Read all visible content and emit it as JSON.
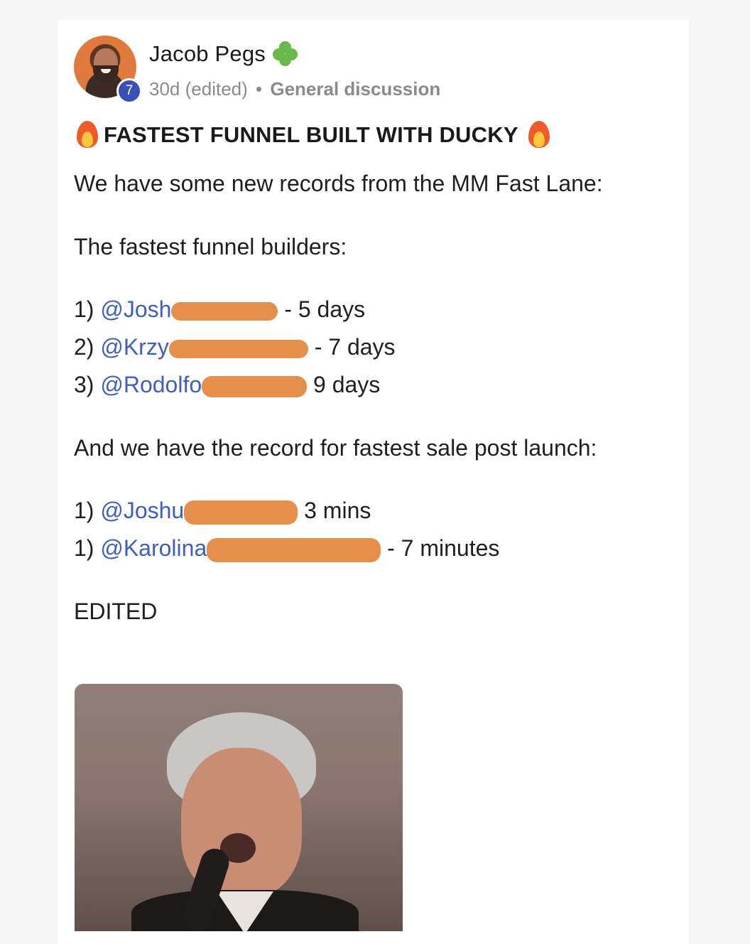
{
  "post": {
    "author": {
      "name": "Jacob Pegs",
      "level": "7",
      "badge_icon": "clover-icon"
    },
    "meta": {
      "age": "30d",
      "edited": "(edited)",
      "separator": "•",
      "category": "General discussion"
    },
    "title": "FASTEST FUNNEL BUILT WITH DUCKY",
    "intro": "We have some new records from the MM Fast Lane:",
    "builders_heading": "The fastest funnel builders:",
    "builders": [
      {
        "rank": "1)",
        "mention": "@Josh",
        "result": "- 5 days"
      },
      {
        "rank": "2)",
        "mention": "@Krzy",
        "result": "- 7 days"
      },
      {
        "rank": "3)",
        "mention": "@Rodolfo",
        "result": "9 days"
      }
    ],
    "sales_heading": "And we have the record for fastest sale post launch:",
    "sales": [
      {
        "rank": "1)",
        "mention": "@Joshu",
        "result": "3 mins"
      },
      {
        "rank": "1)",
        "mention": "@Karolina",
        "result": "- 7 minutes"
      }
    ],
    "footer": "EDITED"
  },
  "colors": {
    "mention": "#3f5fbf",
    "redaction": "#e58f4a",
    "level_badge": "#3b4fb8"
  }
}
